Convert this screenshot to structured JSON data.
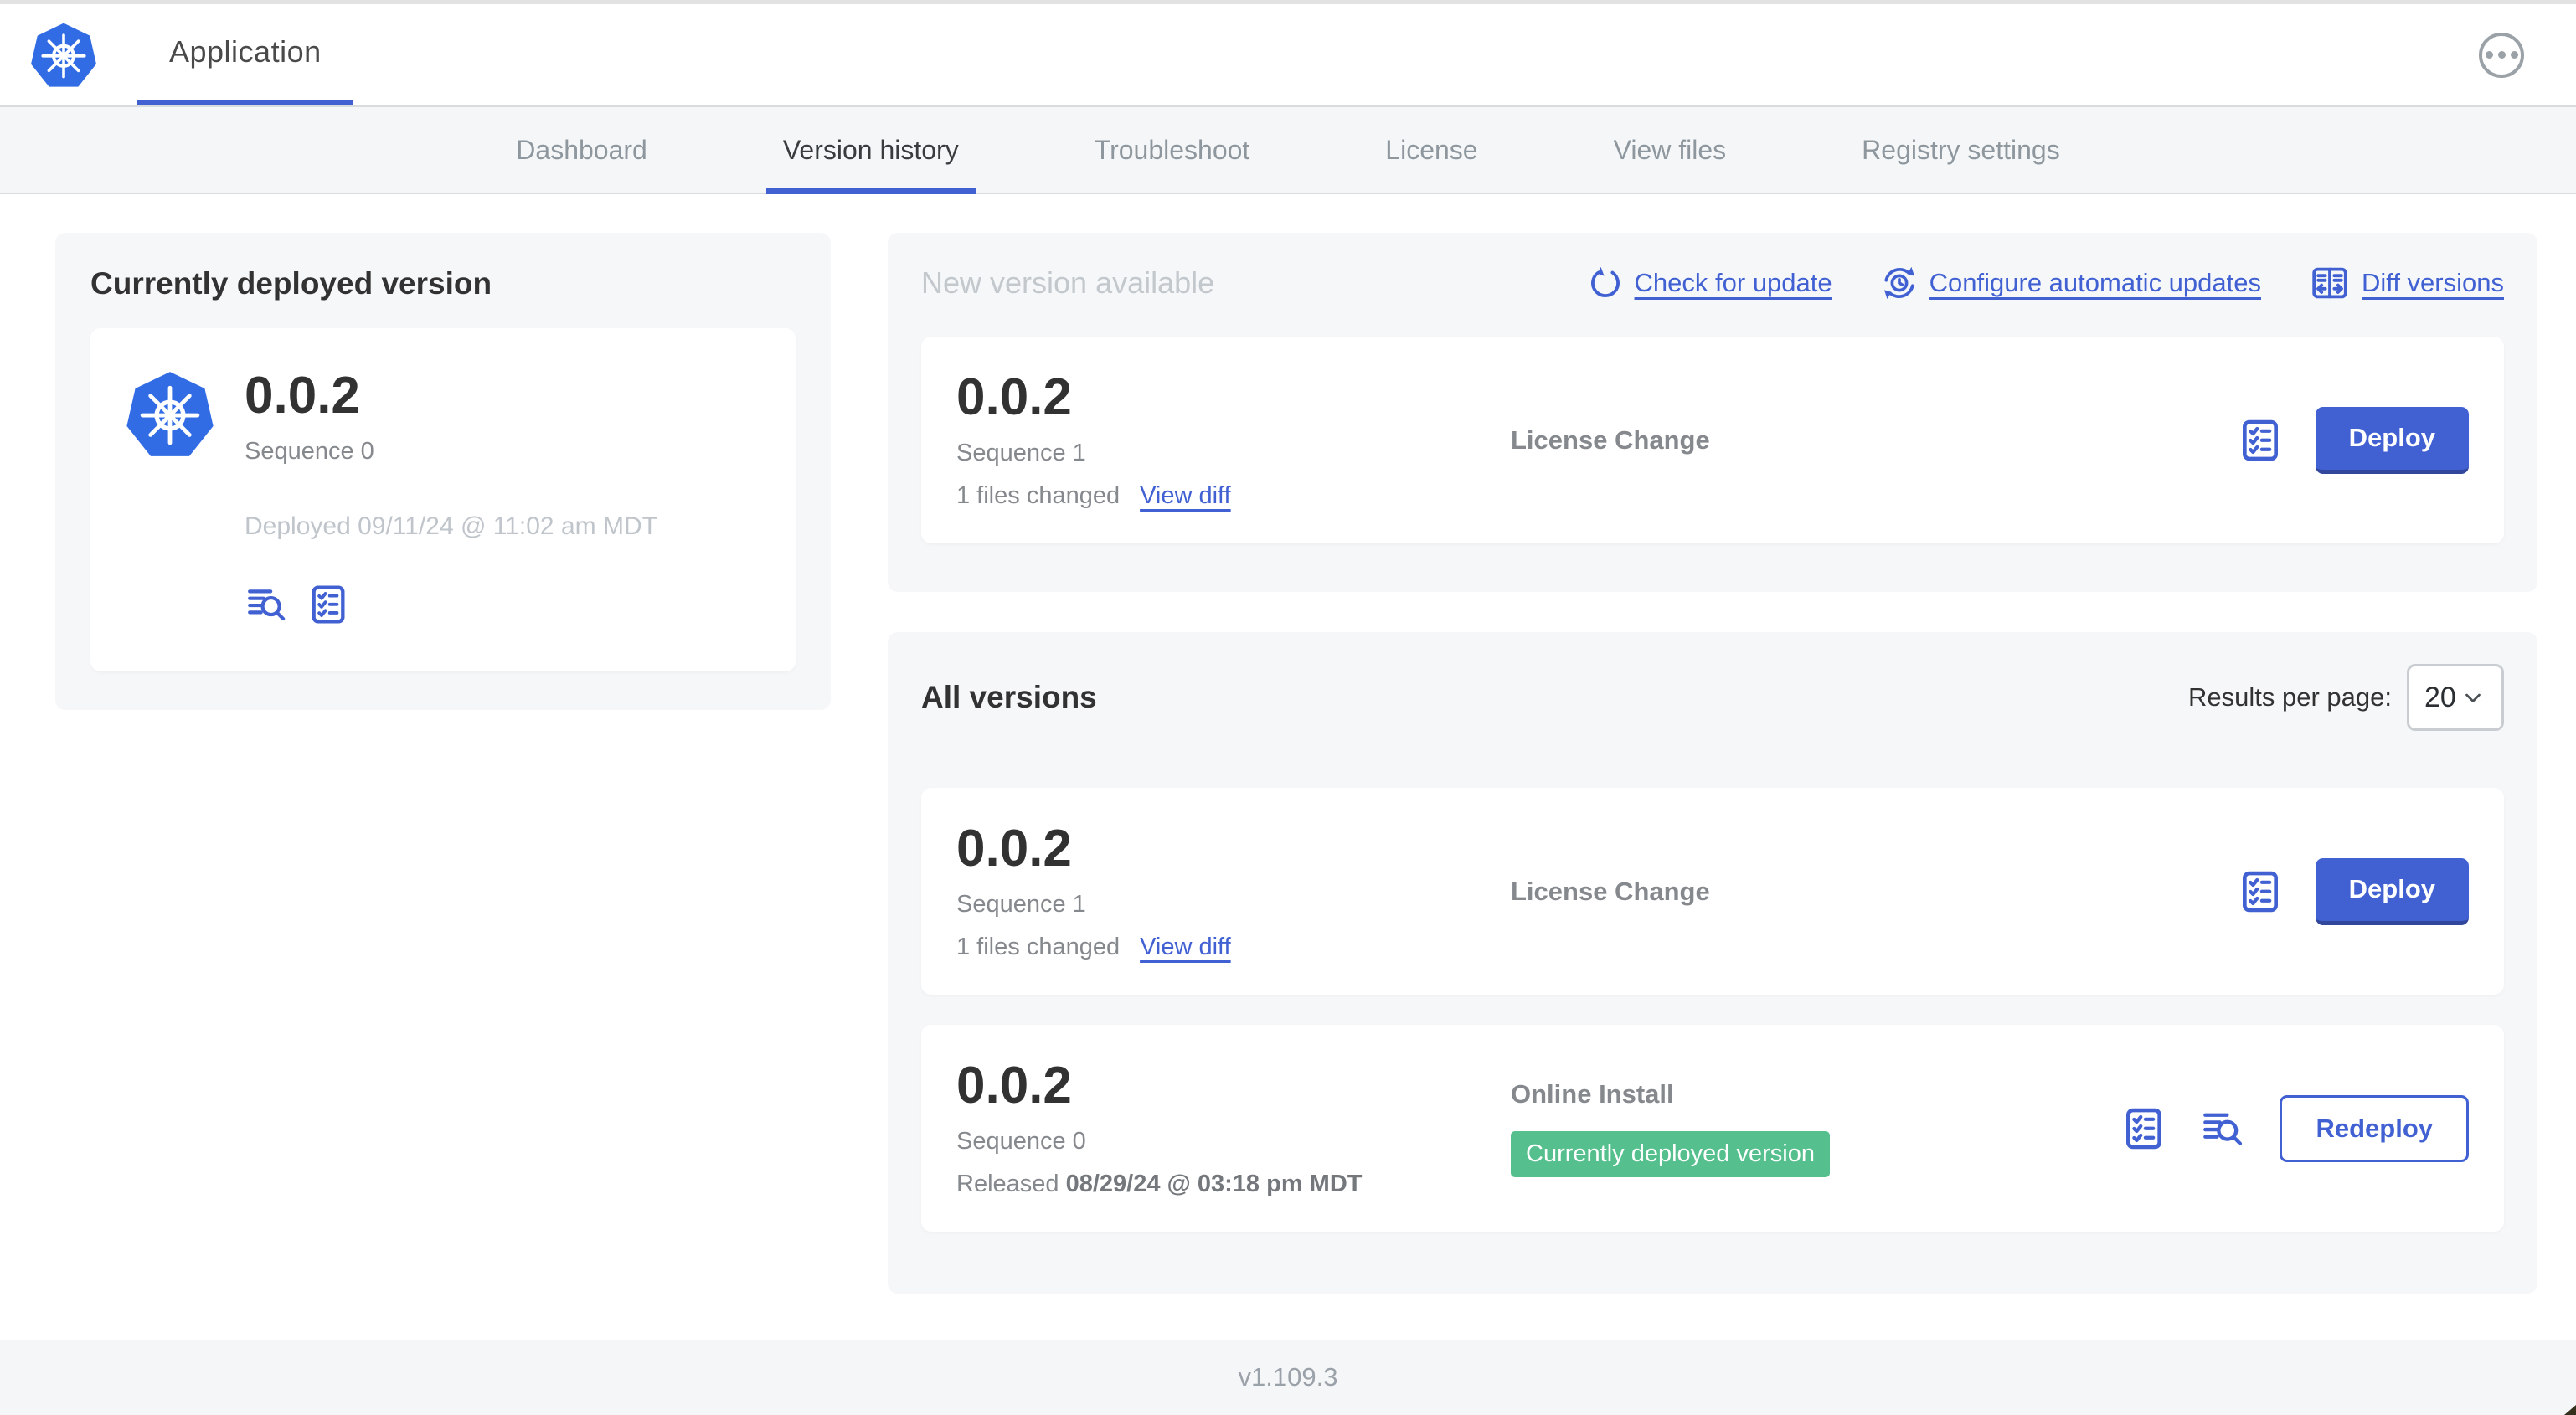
{
  "topbar": {
    "app_title": "Application"
  },
  "nav": {
    "active_tab": "Version history",
    "tabs": [
      {
        "label": "Dashboard"
      },
      {
        "label": "Version history"
      },
      {
        "label": "Troubleshoot"
      },
      {
        "label": "License"
      },
      {
        "label": "View files"
      },
      {
        "label": "Registry settings"
      }
    ]
  },
  "current_version_card": {
    "title": "Currently deployed version",
    "version": "0.0.2",
    "sequence": "Sequence 0",
    "deployed": "Deployed 09/11/24 @ 11:02 am MDT",
    "icons": [
      "file-logs-icon",
      "preflight-checklist-icon"
    ]
  },
  "new_version_card": {
    "title": "New version available",
    "actions": [
      {
        "label": "Check for update",
        "icon": "refresh-icon"
      },
      {
        "label": "Configure automatic updates",
        "icon": "auto-update-clock-icon"
      },
      {
        "label": "Diff versions",
        "icon": "diff-icon"
      }
    ],
    "row": {
      "version": "0.0.2",
      "sequence": "Sequence 1",
      "files_changed": "1 files changed",
      "view_diff_label": "View diff",
      "source": "License Change",
      "deploy_label": "Deploy"
    }
  },
  "all_versions_card": {
    "title": "All versions",
    "results_per_page_label": "Results per page:",
    "results_per_page_value": "20",
    "rows": [
      {
        "version": "0.0.2",
        "sequence": "Sequence 1",
        "files_changed": "1 files changed",
        "view_diff_label": "View diff",
        "source": "License Change",
        "action_label": "Deploy"
      },
      {
        "version": "0.0.2",
        "sequence": "Sequence 0",
        "released_prefix": "Released",
        "released_date": "08/29/24 @ 03:18 pm MDT",
        "source": "Online Install",
        "badge": "Currently deployed version",
        "action_label": "Redeploy"
      }
    ]
  },
  "footer": {
    "app_version": "v1.109.3"
  },
  "colors": {
    "primary_blue": "#4161d3",
    "k8s_blue": "#326ce5",
    "badge_green": "#55c08d",
    "card_bg": "#f5f7f9",
    "muted_text": "#85898d",
    "light_text": "#bfc5cb"
  }
}
